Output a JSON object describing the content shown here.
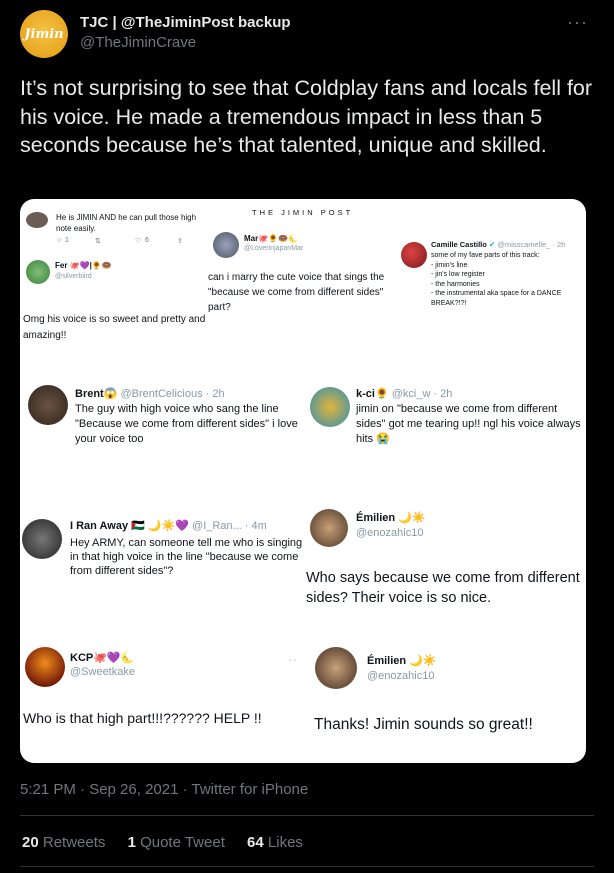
{
  "author": {
    "avatar_text": "Jimin",
    "name": "TJC | @TheJiminPost backup",
    "handle": "@TheJiminCrave"
  },
  "more_label": "···",
  "tweet_text": "It’s not surprising to see that Coldplay fans and locals fell for his voice. He made a tremendous impact in less than 5 seconds because he’s that talented, unique and skilled.",
  "card": {
    "watermark": "THE JIMIN POST",
    "tweets": {
      "t1": {
        "text": "He is JIMIN AND he can pull those high note easily.",
        "actions": [
          "1",
          "",
          "6",
          ""
        ]
      },
      "t2": {
        "name": "Fer 🐙💜|🌻🍩",
        "handle": "@silverbiird",
        "text": "Omg his voice is so sweet and pretty and amazing!!"
      },
      "t3": {
        "name": "Mar🐙🌻🍩🌜",
        "handle": "@LoverinjapanMar",
        "text": "can i marry the cute voice that sings the \"because we come from different sides\" part?"
      },
      "t4": {
        "name": "Camille Castillo",
        "handle": "@misscamelle_ · 2h",
        "lines": [
          "some of my fave parts of this track:",
          "- jimin's line",
          "- jin's low register",
          "- the harmonies",
          "- the instrumental aka space for a DANCE BREAK?!?!"
        ]
      },
      "t5": {
        "name": "Brent😱",
        "handle": "@BrentCelicious · 2h",
        "text": "The guy with high voice who sang the line \"Because we come from different sides\" i love your voice too"
      },
      "t6": {
        "name": "k-ci🌻",
        "handle": "@kci_w · 2h",
        "text": "jimin on \"because we come from different sides\" got me tearing up!! ngl his voice always hits 😭"
      },
      "t7": {
        "name": "I Ran Away 🇵🇸 🌙☀️💜",
        "handle": "@I_Ran... · 4m",
        "text": "Hey ARMY, can someone tell me who is singing in that high voice in the line \"because we come from different sides\"?"
      },
      "t8": {
        "name": "Émilien 🌙☀️",
        "handle": "@enozahic10",
        "text": "Who says because we come from different sides? Their voice is so nice."
      },
      "t9": {
        "name": "KCP🐙💜🌜",
        "handle": "@Sweetkake",
        "text": "Who is that high part!!!?????? HELP !!"
      },
      "t10": {
        "name": "Émilien 🌙☀️",
        "handle": "@enozahic10",
        "text": "Thanks! Jimin sounds so great!!"
      }
    }
  },
  "meta": "5:21 PM · Sep 26, 2021 · Twitter for iPhone",
  "stats": {
    "retweets_count": "20",
    "retweets_label": "Retweets",
    "quotes_count": "1",
    "quotes_label": "Quote Tweet",
    "likes_count": "64",
    "likes_label": "Likes"
  }
}
